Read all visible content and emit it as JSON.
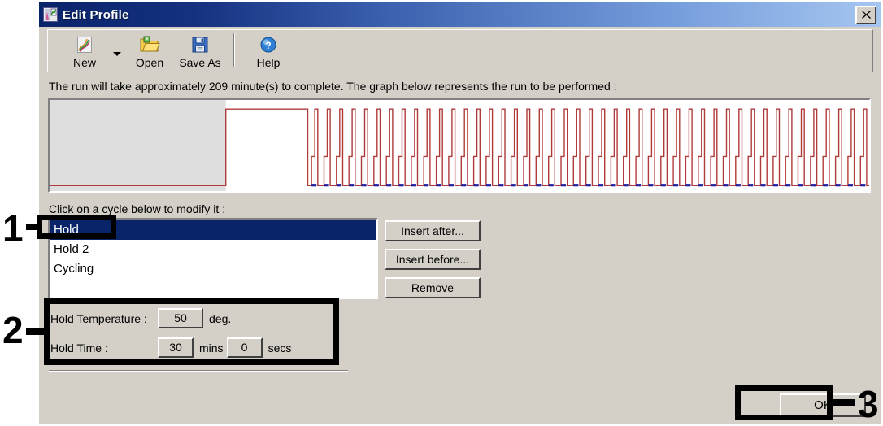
{
  "window": {
    "title": "Edit Profile",
    "icon": "app-profile-icon",
    "close_label": "✕"
  },
  "toolbar": {
    "items": [
      {
        "label": "New",
        "icon": "new-document-icon"
      },
      {
        "label": "Open",
        "icon": "open-folder-icon"
      },
      {
        "label": "Save As",
        "icon": "floppy-disk-save-icon"
      },
      {
        "label": "Help",
        "icon": "help-question-icon"
      }
    ],
    "dropdown_icon": "chevron-down-icon"
  },
  "info": {
    "run_text": "The run will take approximately 209 minute(s) to complete. The graph below represents the run to be performed :"
  },
  "instruction": {
    "text": "Click on a cycle below to modify it :"
  },
  "cycle_list": {
    "items": [
      "Hold",
      "Hold 2",
      "Cycling"
    ],
    "selected_index": 0
  },
  "side_buttons": {
    "insert_after": "Insert after...",
    "insert_before": "Insert before...",
    "remove": "Remove"
  },
  "hold_params": {
    "temperature_label": "Hold Temperature :",
    "temperature_value": "50",
    "temperature_unit": "deg.",
    "time_label": "Hold Time :",
    "minutes_value": "30",
    "minutes_unit": "mins",
    "seconds_value": "0",
    "seconds_unit": "secs"
  },
  "footer": {
    "ok_label": "OK",
    "ok_accelerator": "O"
  },
  "annotations": [
    {
      "number": "1",
      "target": "cycle-list-selected-hold"
    },
    {
      "number": "2",
      "target": "hold-parameters-group"
    },
    {
      "number": "3",
      "target": "ok-button"
    }
  ],
  "colors": {
    "title_bar_start": "#0a246a",
    "title_bar_end": "#a6c6f0",
    "dialog_face": "#d4d0c8",
    "selection": "#0a246a",
    "graph_trace": "#b03a3a",
    "graph_acquire": "#2020a0",
    "graph_selected_band": "#dedede",
    "annotation": "#000000"
  },
  "graph": {
    "description": "Thermal profile trace: selected Hold band, Hold 2 plateau, then repeated cycling peaks with acquisition marks",
    "selected_band_end_ratio": 0.215,
    "hold2_plateau_end_ratio": 0.315,
    "cycle_count": 45,
    "trace_levels": {
      "hold_low": 0.94,
      "hold2_high": 0.1,
      "cycle_peak": 0.1,
      "cycle_mid": 0.62,
      "cycle_low": 0.94
    }
  }
}
